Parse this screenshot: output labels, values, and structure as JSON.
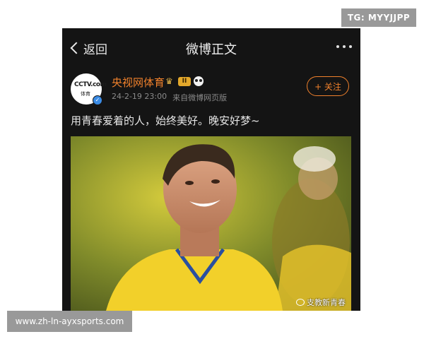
{
  "nav": {
    "back_label": "返回",
    "title": "微博正文"
  },
  "author": {
    "name": "央视网体育",
    "avatar_text_top": "CCTV.com",
    "avatar_text_bottom": "体育",
    "level_badge": "II",
    "timestamp": "24-2-19 23:00",
    "source": "来自微博网页版",
    "follow_label": "+ 关注"
  },
  "post": {
    "text": "用青春爱着的人，始终美好。晚安好梦~"
  },
  "image": {
    "credit": "支教新青春"
  },
  "watermarks": {
    "tg": "TG: MYYJJPP",
    "site": "www.zh-ln-ayxsports.com"
  },
  "colors": {
    "accent": "#f0812c",
    "background": "#141414",
    "jersey": "#f2d02a"
  },
  "icons": [
    "back-chevron-icon",
    "more-dots-icon",
    "verified-icon",
    "crown-icon",
    "panda-icon",
    "weibo-icon"
  ]
}
